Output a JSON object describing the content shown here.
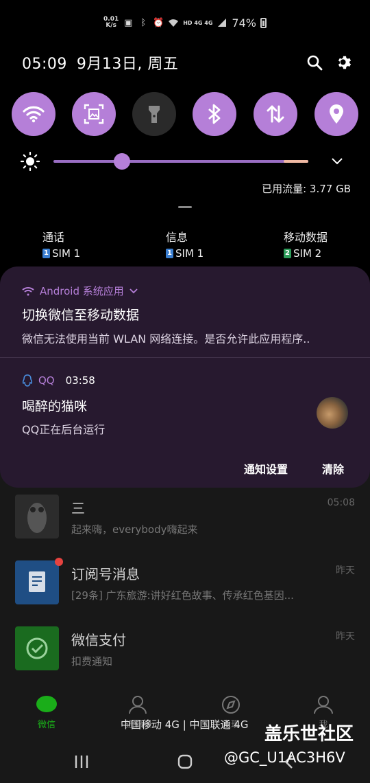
{
  "status_bar": {
    "net_speed_value": "0.01",
    "net_speed_unit": "K/s",
    "network_labels": "HD 4G 4G",
    "battery_percent": "74%"
  },
  "header": {
    "time": "05:09",
    "date": "9月13日, 周五"
  },
  "quick_tiles": [
    {
      "icon": "wifi-icon",
      "active": true
    },
    {
      "icon": "screenshot-icon",
      "active": true
    },
    {
      "icon": "flashlight-icon",
      "active": false
    },
    {
      "icon": "bluetooth-icon",
      "active": true
    },
    {
      "icon": "mobile-data-icon",
      "active": true
    },
    {
      "icon": "location-icon",
      "active": true
    }
  ],
  "brightness": {
    "level": 0.27
  },
  "data_usage": "已用流量: 3.77 GB",
  "sim_defaults": [
    {
      "label": "通话",
      "sim": "SIM 1",
      "slot": "1",
      "color": "#3b7fd1"
    },
    {
      "label": "信息",
      "sim": "SIM 1",
      "slot": "1",
      "color": "#3b7fd1"
    },
    {
      "label": "移动数据",
      "sim": "SIM 2",
      "slot": "2",
      "color": "#2e9c5a"
    }
  ],
  "notifications": [
    {
      "app": "Android 系统应用",
      "title": "切换微信至移动数据",
      "text": "微信无法使用当前 WLAN 网络连接。是否允许此应用程序.."
    },
    {
      "app": "QQ",
      "time": "03:58",
      "title": "喝醉的猫咪",
      "text": "QQ正在后台运行"
    }
  ],
  "notif_actions": {
    "settings": "通知设置",
    "clear": "清除"
  },
  "background_chats": [
    {
      "name": "三",
      "msg": "起来嗨，everybody嗨起来",
      "time": "05:08"
    },
    {
      "name": "订阅号消息",
      "msg": "[29条] 广东旅游:讲好红色故事、传承红色基因...",
      "time": "昨天"
    },
    {
      "name": "微信支付",
      "msg": "扣费通知",
      "time": "昨天"
    }
  ],
  "bottom_nav": {
    "chats": "微信",
    "contacts": "通讯录",
    "discover": "发现",
    "me": "我"
  },
  "carrier_text": "中国移动 4G | 中国联通 4G",
  "watermark": {
    "title": "盖乐世社区",
    "handle": "@GC_U1AC3H6V"
  },
  "colors": {
    "accent": "#b57fd8",
    "panel": "#27192f",
    "tile_off": "#2a2a2a"
  }
}
